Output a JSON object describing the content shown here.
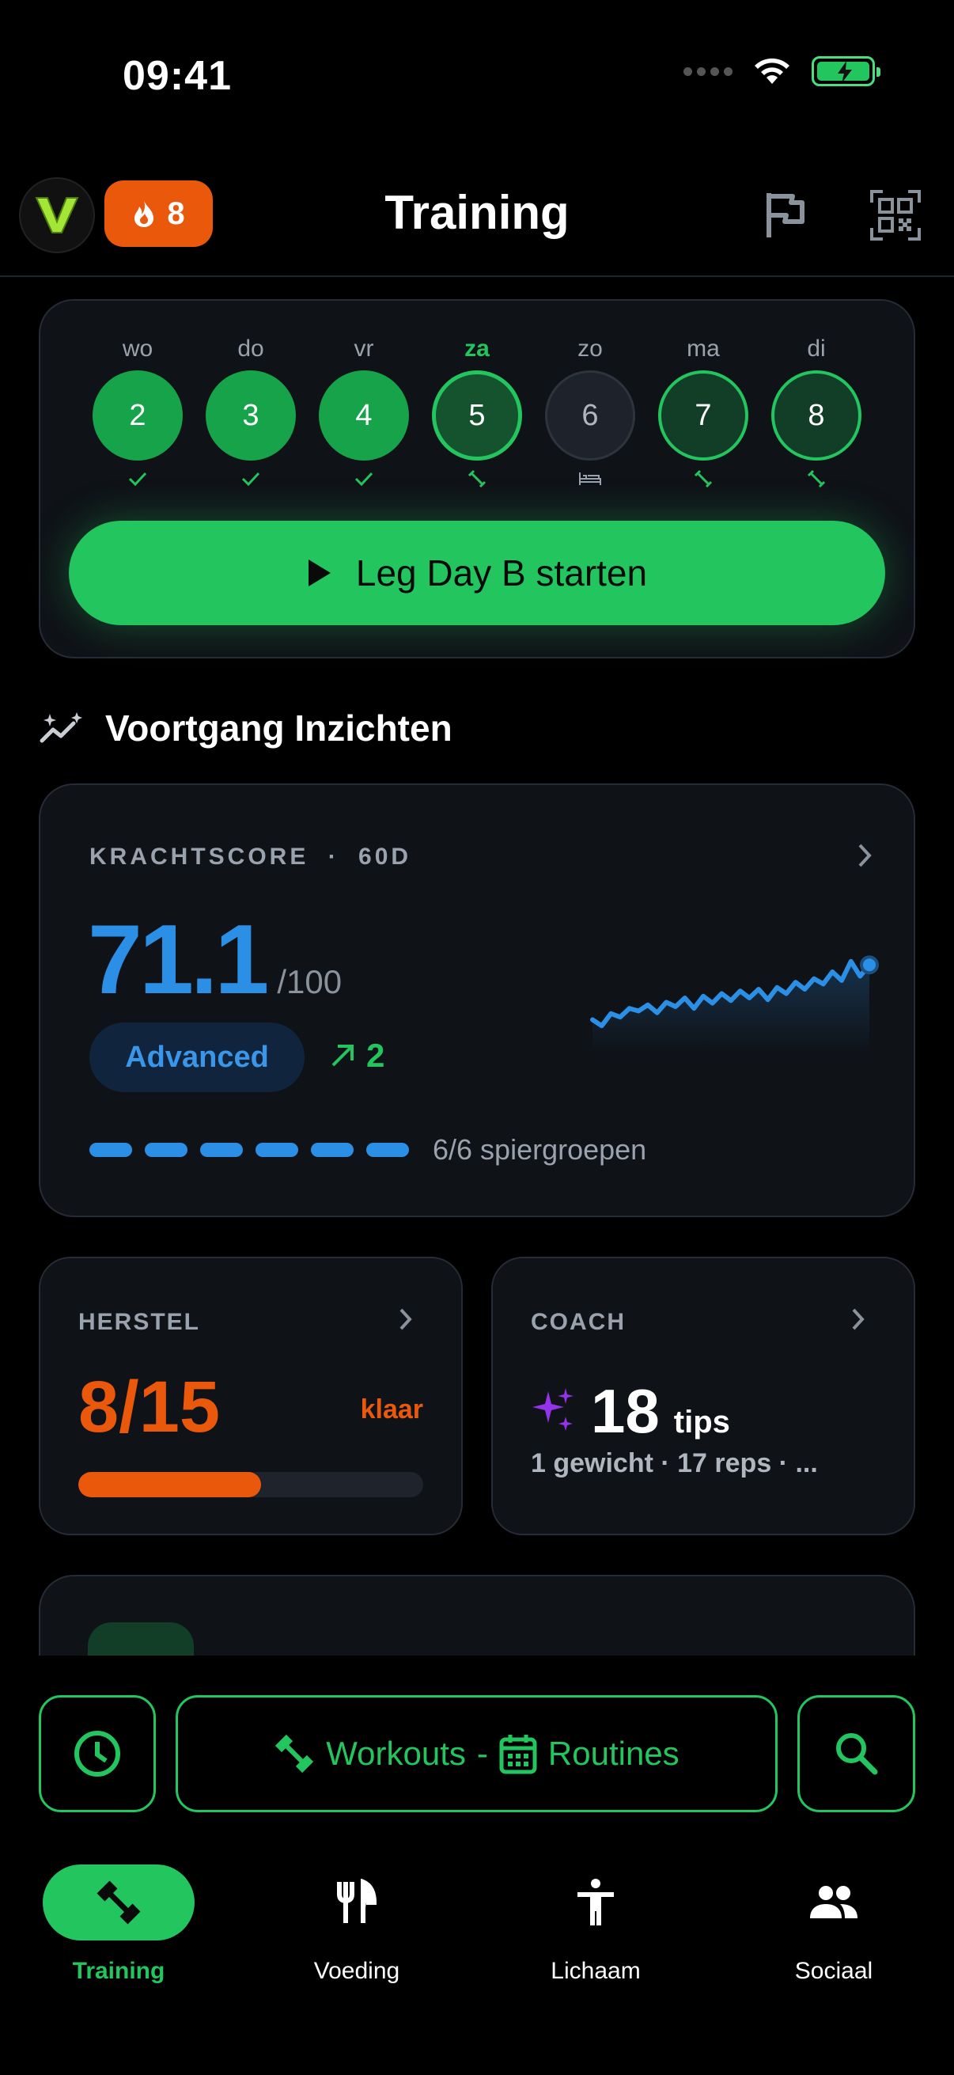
{
  "status": {
    "time": "09:41"
  },
  "header": {
    "title": "Training",
    "streak_count": "8",
    "avatar_letter": "V"
  },
  "week": {
    "days": [
      {
        "label": "wo",
        "number": "2",
        "state": "done"
      },
      {
        "label": "do",
        "number": "3",
        "state": "done"
      },
      {
        "label": "vr",
        "number": "4",
        "state": "done"
      },
      {
        "label": "za",
        "number": "5",
        "state": "today"
      },
      {
        "label": "zo",
        "number": "6",
        "state": "rest"
      },
      {
        "label": "ma",
        "number": "7",
        "state": "planned"
      },
      {
        "label": "di",
        "number": "8",
        "state": "planned"
      }
    ],
    "start_label": "Leg Day B starten"
  },
  "insights": {
    "title": "Voortgang Inzichten",
    "kracht": {
      "label": "KRACHTSCORE",
      "sep": "·",
      "period": "60D",
      "score": "71.1",
      "score_max": "/100",
      "level": "Advanced",
      "trend": "2",
      "muscle_groups": "6/6 spiergroepen",
      "sparkline": [
        0.25,
        0.18,
        0.32,
        0.28,
        0.38,
        0.35,
        0.42,
        0.33,
        0.45,
        0.4,
        0.5,
        0.38,
        0.52,
        0.44,
        0.55,
        0.47,
        0.58,
        0.5,
        0.6,
        0.48,
        0.62,
        0.55,
        0.68,
        0.6,
        0.72,
        0.66,
        0.8,
        0.7,
        0.92,
        0.75,
        0.88
      ]
    },
    "herstel": {
      "label": "HERSTEL",
      "value": "8/15",
      "status": "klaar",
      "progress": 0.53
    },
    "coach": {
      "label": "COACH",
      "count": "18",
      "unit": "tips",
      "summary": "1 gewicht · 17 reps · ..."
    }
  },
  "actions": {
    "workouts": "Workouts",
    "dash": "-",
    "routines": "Routines"
  },
  "nav": [
    {
      "label": "Training",
      "icon": "dumbbell-icon",
      "active": true
    },
    {
      "label": "Voeding",
      "icon": "fork-knife-icon",
      "active": false
    },
    {
      "label": "Lichaam",
      "icon": "person-icon",
      "active": false
    },
    {
      "label": "Sociaal",
      "icon": "group-icon",
      "active": false
    }
  ],
  "colors": {
    "accent": "#22c55e",
    "score_blue": "#2b8fe6",
    "orange": "#ea580c",
    "purple": "#9333ea"
  }
}
